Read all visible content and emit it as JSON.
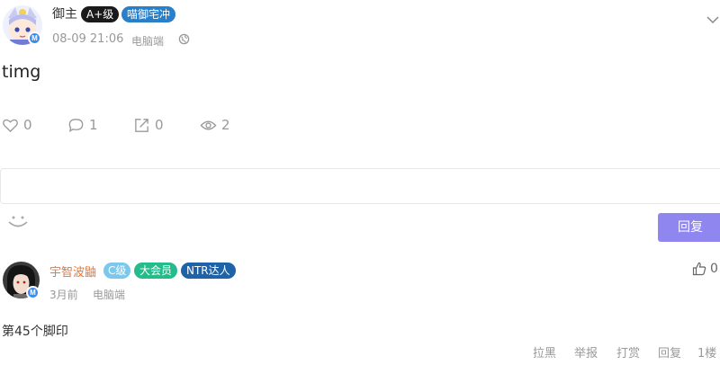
{
  "post": {
    "author": "御主",
    "level_badge": "A+级",
    "title_badge": "喵御宅冲",
    "timestamp": "08-09 21:06",
    "device": "电脑端",
    "text": "timg",
    "stats": {
      "likes": "0",
      "comments": "1",
      "shares": "0",
      "views": "2"
    }
  },
  "composer": {
    "placeholder": "",
    "reply_label": "回复"
  },
  "comment": {
    "author": "宇智波鼬",
    "level_badge": "C级",
    "member_badge": "大会员",
    "title_badge": "NTR达人",
    "time": "3月前",
    "device": "电脑端",
    "likes": "0",
    "text": "第45个脚印",
    "actions": {
      "block": "拉黑",
      "report": "举报",
      "tip": "打赏",
      "reply": "回复",
      "floor": "1楼"
    }
  },
  "avatar_badge_letter": "M",
  "colors": {
    "black_badge": "#1a1a1a",
    "blue_badge": "#2a7fc9",
    "light_blue_badge": "#7cc8ec",
    "green_badge": "#26bb8a",
    "dark_blue_badge": "#1e63a8",
    "commenter_name": "#e8773d",
    "reply_button": "#8f86f0"
  }
}
